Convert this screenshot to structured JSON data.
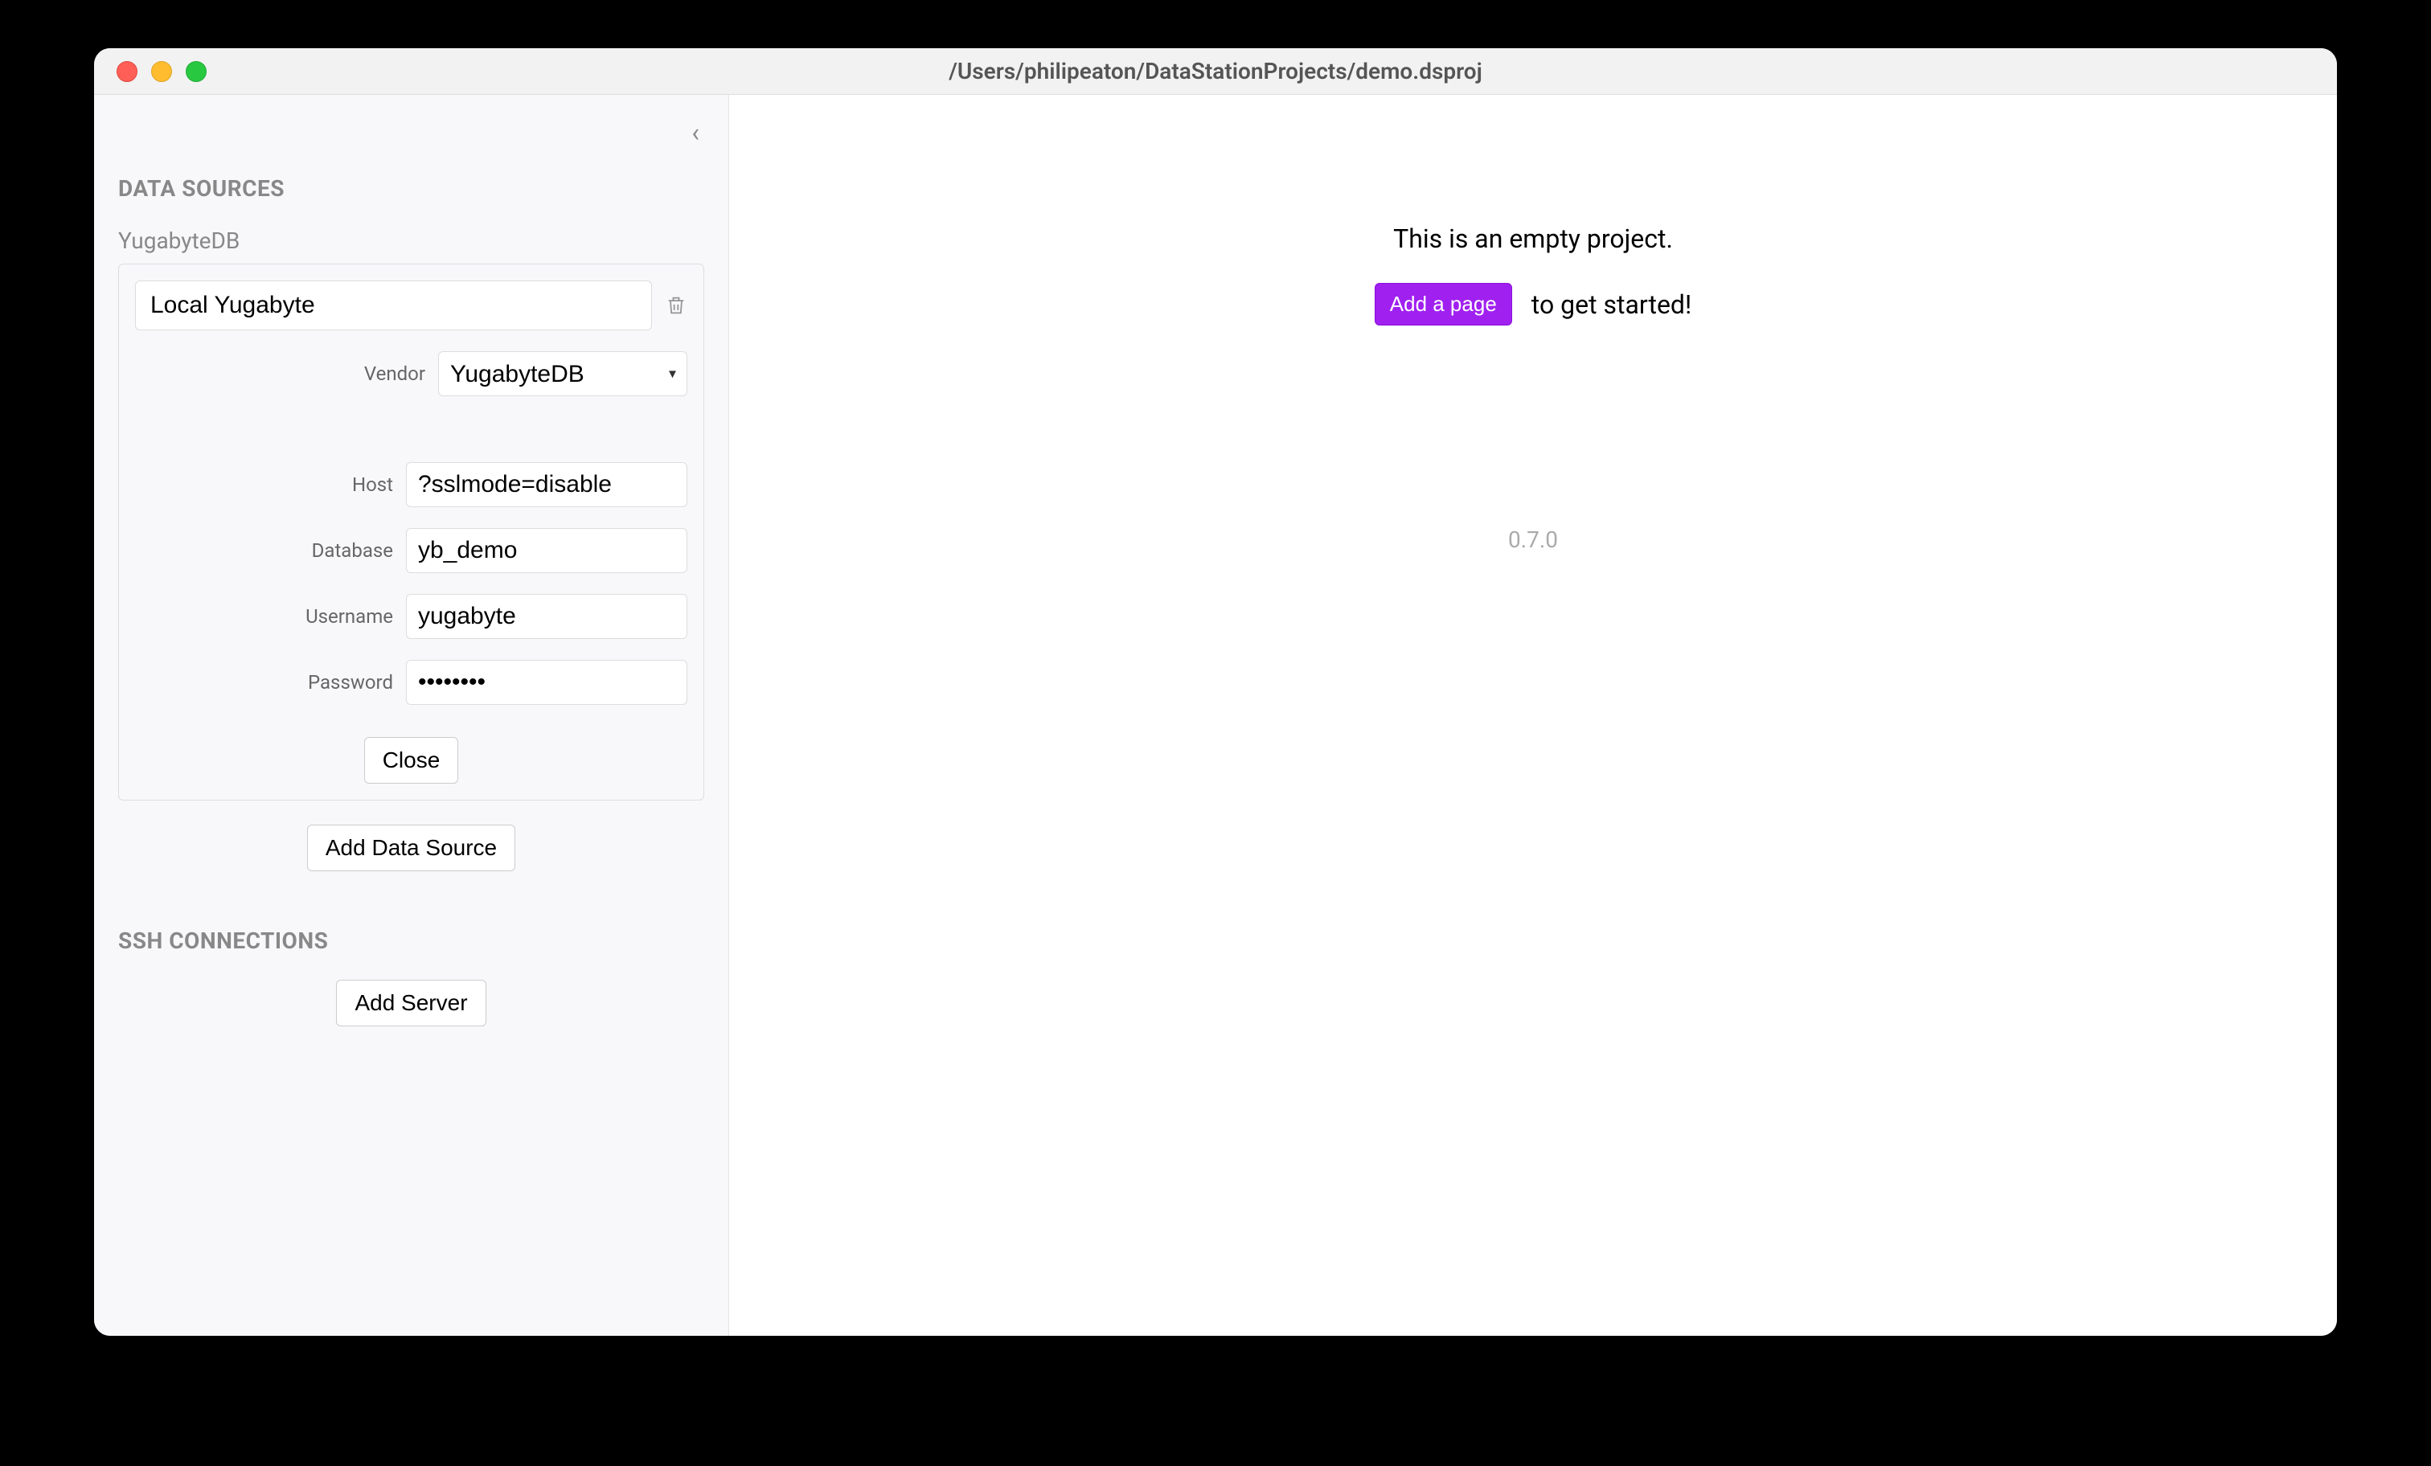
{
  "window": {
    "title": "/Users/philipeaton/DataStationProjects/demo.dsproj"
  },
  "sidebar": {
    "sections": {
      "data_sources_header": "DATA SOURCES",
      "ssh_connections_header": "SSH CONNECTIONS"
    },
    "data_source": {
      "type_label": "YugabyteDB",
      "name_value": "Local Yugabyte",
      "fields": {
        "vendor_label": "Vendor",
        "vendor_value": "YugabyteDB",
        "host_label": "Host",
        "host_value": "?sslmode=disable",
        "database_label": "Database",
        "database_value": "yb_demo",
        "username_label": "Username",
        "username_value": "yugabyte",
        "password_label": "Password",
        "password_value": "••••••••"
      },
      "close_label": "Close"
    },
    "add_data_source_label": "Add Data Source",
    "add_server_label": "Add Server"
  },
  "main": {
    "empty_message": "This is an empty project.",
    "add_page_label": "Add a page",
    "get_started_text": "to get started!",
    "version": "0.7.0"
  }
}
